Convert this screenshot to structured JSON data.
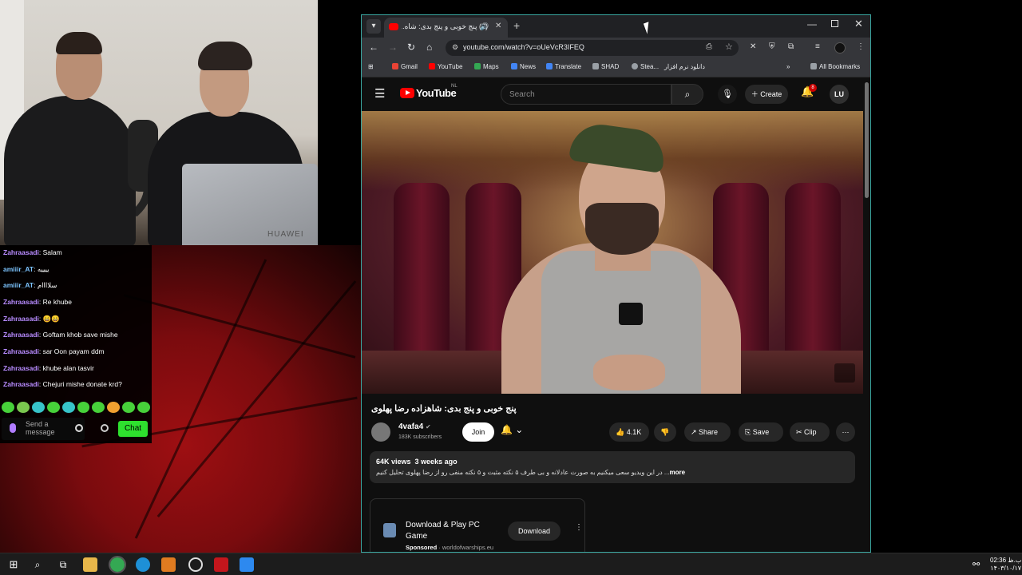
{
  "chat": {
    "messages": [
      {
        "user": "Zahraasadi",
        "text": "Salam",
        "color": "purple"
      },
      {
        "user": "amiiir_AT",
        "text": "ییییه",
        "color": "blue"
      },
      {
        "user": "amiiir_AT",
        "text": "سلاااام",
        "color": "blue"
      },
      {
        "user": "Zahraasadi",
        "text": "Re khube",
        "color": "purple"
      },
      {
        "user": "Zahraasadi",
        "text": "😄😄",
        "color": "purple"
      },
      {
        "user": "Zahraasadi",
        "text": "Goftam khob save mishe",
        "color": "purple"
      },
      {
        "user": "Zahraasadi",
        "text": "sar Oon payam ddm",
        "color": "purple"
      },
      {
        "user": "Zahraasadi",
        "text": "khube alan tasvir",
        "color": "purple"
      },
      {
        "user": "Zahraasadi",
        "text": "Chejuri mishe donate krd?",
        "color": "purple"
      }
    ],
    "send_placeholder": "Send a message",
    "chat_button": "Chat"
  },
  "webcam": {
    "laptop_brand": "HUAWEI"
  },
  "browser": {
    "tab_title": "(8) پنج خوبی و پنج بدی: شاه...",
    "url": "youtube.com/watch?v=oUeVcR3IFEQ",
    "bookmarks": [
      {
        "label": "Gmail",
        "color": "#ea4335"
      },
      {
        "label": "YouTube",
        "color": "#ff0000"
      },
      {
        "label": "Maps",
        "color": "#34a853"
      },
      {
        "label": "News",
        "color": "#4285f4"
      },
      {
        "label": "Translate",
        "color": "#4285f4"
      },
      {
        "label": "SHAD",
        "color": "#9aa0a6"
      },
      {
        "label": "Stea...",
        "color": "#9aa0a6"
      },
      {
        "label": "دانلود نرم افزار",
        "color": "#9aa0a6"
      }
    ],
    "all_bookmarks": "All Bookmarks"
  },
  "youtube": {
    "logo_text": "YouTube",
    "country": "NL",
    "search_placeholder": "Search",
    "create_label": "Create",
    "notification_count": "8",
    "avatar_initials": "LU",
    "video_title": "پنج خوبی و پنج بدی: شاهزاده رضا پهلوی",
    "channel_name": "4vafa4",
    "subscribers": "183K subscribers",
    "join_label": "Join",
    "likes": "4.1K",
    "share_label": "Share",
    "save_label": "Save",
    "clip_label": "Clip",
    "views": "64K views",
    "age": "3 weeks ago",
    "description": "در این ویدیو سعی میکنیم به صورت عادلانه و بی طرف ۵ نکته مثبت و ۵ نکته منفی رو از رضا پهلوی تحلیل کنیم ...",
    "more_label": "more",
    "ad_title": "Download & Play PC Game",
    "ad_sponsored": "Sponsored",
    "ad_domain": "worldofwarships.eu",
    "ad_button": "Download"
  },
  "taskbar": {
    "time": "02:36 ب.ظ",
    "date": "۱۴۰۳/۱۰/۱۷"
  }
}
